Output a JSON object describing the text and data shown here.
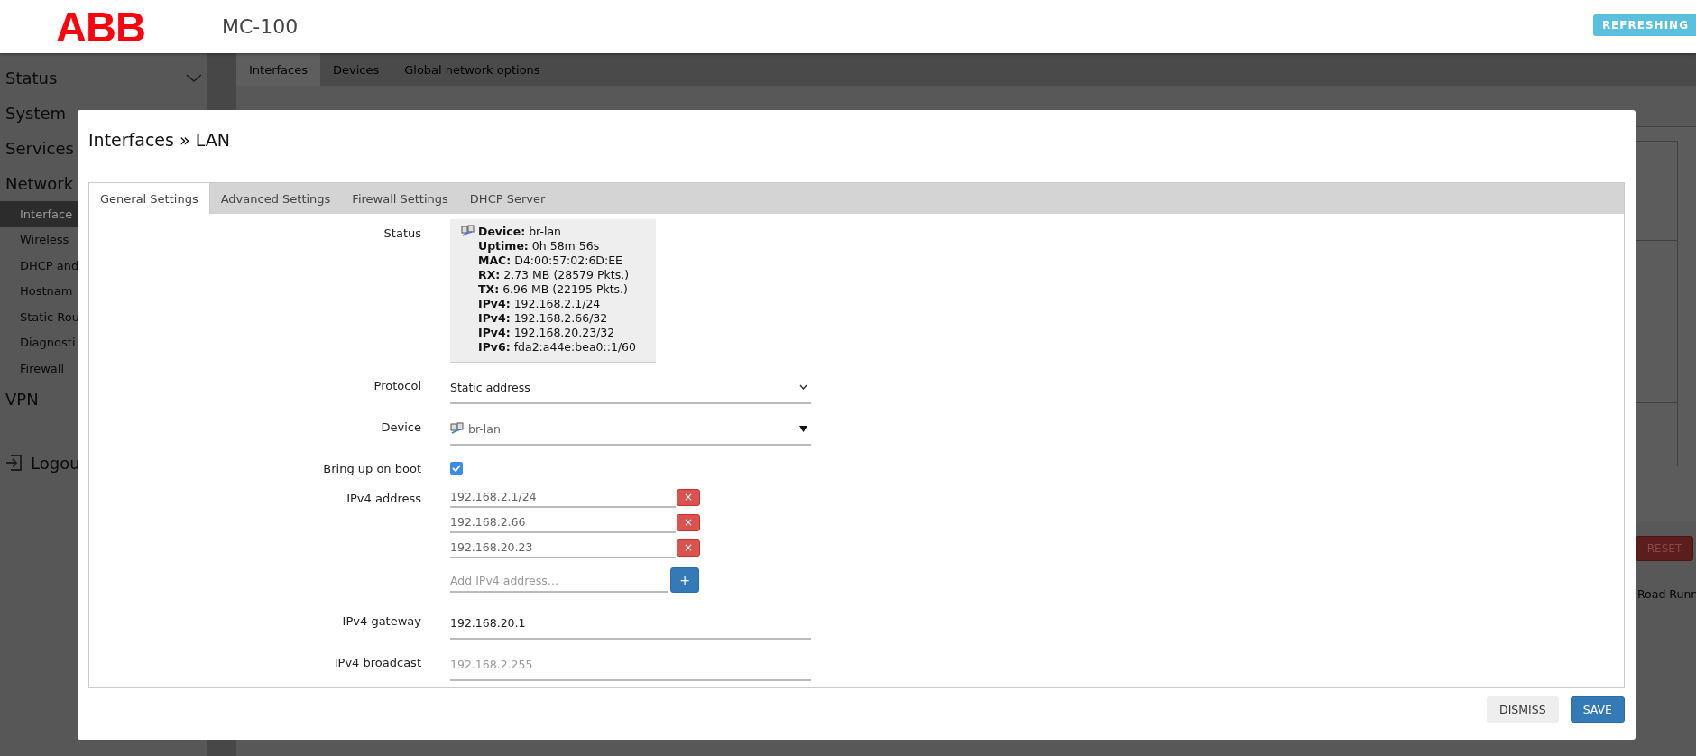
{
  "header": {
    "logo": "ABB",
    "title": "MC-100",
    "badge": "REFRESHING"
  },
  "sidebar": {
    "items": [
      {
        "label": "Status",
        "kind": "collapsible",
        "selected": false
      },
      {
        "label": "System",
        "kind": "group",
        "selected": false
      },
      {
        "label": "Services",
        "kind": "group",
        "selected": false
      },
      {
        "label": "Network",
        "kind": "group",
        "selected": false
      },
      {
        "label": "Interface",
        "kind": "sub",
        "selected": true
      },
      {
        "label": "Wireless",
        "kind": "sub",
        "selected": false
      },
      {
        "label": "DHCP and",
        "kind": "sub",
        "selected": false
      },
      {
        "label": "Hostnam",
        "kind": "sub",
        "selected": false
      },
      {
        "label": "Static Rou",
        "kind": "sub",
        "selected": false
      },
      {
        "label": "Diagnosti",
        "kind": "sub",
        "selected": false
      },
      {
        "label": "Firewall",
        "kind": "sub",
        "selected": false
      },
      {
        "label": "VPN",
        "kind": "group",
        "selected": false
      },
      {
        "label": "Logou",
        "kind": "logout",
        "selected": false
      }
    ]
  },
  "page": {
    "tabs": [
      {
        "label": "Interfaces",
        "selected": true
      },
      {
        "label": "Devices",
        "selected": false
      },
      {
        "label": "Global network options",
        "selected": false
      }
    ],
    "reset_button": "RESET",
    "footer_text": "Road Runn"
  },
  "dialog": {
    "title": "Interfaces » LAN",
    "tabs": [
      {
        "label": "General Settings",
        "selected": true
      },
      {
        "label": "Advanced Settings",
        "selected": false
      },
      {
        "label": "Firewall Settings",
        "selected": false
      },
      {
        "label": "DHCP Server",
        "selected": false
      }
    ],
    "status": {
      "label": "Status",
      "lines": [
        "**Device:** br-lan",
        "**Uptime:** 0h 58m 56s",
        "**MAC:** D4:00:57:02:6D:EE",
        "**RX:** 2.73 MB (28579 Pkts.)",
        "**TX:** 6.96 MB (22195 Pkts.)",
        "**IPv4:** 192.168.2.1/24",
        "**IPv4:** 192.168.2.66/32",
        "**IPv4:** 192.168.20.23/32",
        "**IPv6:** fda2:a44e:bea0::1/60"
      ]
    },
    "protocol": {
      "label": "Protocol",
      "value": "Static address"
    },
    "device": {
      "label": "Device",
      "value": "br-lan"
    },
    "boot": {
      "label": "Bring up on boot",
      "checked": true
    },
    "ipv4_address": {
      "label": "IPv4 address",
      "entries": [
        {
          "value": "192.168.2.1/24",
          "remove": "×"
        },
        {
          "value": "192.168.2.66",
          "remove": "×"
        },
        {
          "value": "192.168.20.23",
          "remove": "×"
        }
      ],
      "placeholder": "Add IPv4 address…",
      "add_button": "+"
    },
    "gateway": {
      "label": "IPv4 gateway",
      "value": "192.168.20.1"
    },
    "broadcast": {
      "label": "IPv4 broadcast",
      "placeholder": "192.168.2.255"
    },
    "buttons": [
      {
        "label": "DISMISS",
        "kind": "secondary"
      },
      {
        "label": "SAVE",
        "kind": "primary"
      }
    ]
  }
}
